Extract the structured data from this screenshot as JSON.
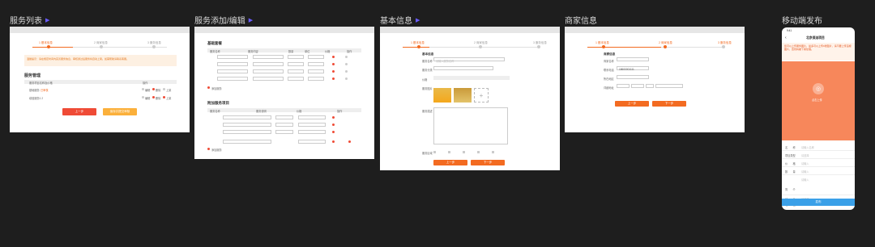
{
  "frames": {
    "list": {
      "title": "服务列表",
      "steps": [
        "1 基本信息",
        "2 商家信息",
        "3 服务信息"
      ],
      "notice": "温馨提示：请在规定时间内完善服务信息，审核通过后服务将自动上架。如需帮助请联系客服。",
      "section": "服务管理",
      "columns": [
        "服务项目名称及价格",
        "操作"
      ],
      "rows": [
        {
          "name": "基础服务",
          "status": "已审核"
        },
        {
          "name": "增值服务1 2",
          "status": ""
        }
      ],
      "ops": [
        "编辑",
        "删除",
        "上架"
      ],
      "btn_prev": "上一步",
      "btn_next": "保存并提交审核"
    },
    "edit": {
      "title": "服务添加/编辑",
      "section1": "基础套餐",
      "cols1": [
        "服务名称",
        "服务内容",
        "数量",
        "单位",
        "价格",
        "操作"
      ],
      "section2": "附加服务项目",
      "cols2": [
        "服务名称",
        "服务说明",
        "价格",
        "操作"
      ],
      "add": "添加服务"
    },
    "basic": {
      "title": "基本信息",
      "steps": [
        "1 基本信息",
        "2 商家信息",
        "3 服务信息"
      ],
      "form_title": "基本信息",
      "labels": [
        "服务名称",
        "服务分类",
        "价格",
        "服务图片",
        "服务描述",
        "服务区域"
      ],
      "placeholder": "请输入服务名称",
      "btn_prev": "上一步",
      "btn_next": "下一步"
    },
    "merchant": {
      "title": "商家信息",
      "steps": [
        "1 基本信息",
        "2 商家信息",
        "3 服务信息"
      ],
      "form_title": "商家信息",
      "labels": [
        "商家名称",
        "联系电话",
        "所在地区",
        "详细地址"
      ],
      "phone_val": "18600001111",
      "btn_prev": "上一步",
      "btn_next": "下一步"
    },
    "mobile": {
      "title": "移动端发布",
      "time": "9:41",
      "nav_title": "北京保洁项目",
      "warn": "您可以上传服务图片，最多可以上传9张图片，请不要上传违规图片，否则将被下架处理。",
      "upload": "点击上传",
      "fields": [
        {
          "label": "名　　称",
          "value": "请输入名称"
        },
        {
          "label": "项目类型",
          "value": "请选择"
        },
        {
          "label": "价　　格",
          "value": "请输入"
        },
        {
          "label": "数　　量",
          "value": "请输入"
        },
        {
          "label": "",
          "value": "请输入"
        },
        {
          "label": "简　　介",
          "value": ""
        },
        {
          "label": "地　　址",
          "value": "请选择"
        },
        {
          "label": "电　　话",
          "value": "18600000000"
        }
      ],
      "submit": "发布"
    }
  },
  "colors": {
    "accent": "#f36b21",
    "yellow": "#fbb03b",
    "mobile_header": "#f7875b",
    "submit": "#3aa0e8"
  }
}
